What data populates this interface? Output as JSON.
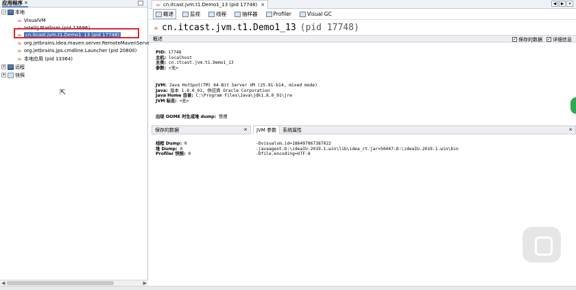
{
  "left_panel": {
    "tab_label": "应用程序",
    "tab_close": "×",
    "tree": {
      "local": "本地",
      "visualvm": "VisualVM",
      "intellij": "IntelliJ Platform (pid 13696)",
      "selected": "cn.itcast.jvm.t1.Demo1_13 (pid 17748)",
      "maven": "org.jetbrains.idea.maven.server.RemoteMavenServe",
      "launcher": "org.jetbrains.jps.cmdline.Launcher (pid 20800)",
      "local_app": "本地应用 (pid 13364)",
      "remote": "远程",
      "snapshot": "快照"
    },
    "expander_open": "−",
    "expander_closed": "+"
  },
  "right_panel": {
    "tab_label": "cn.itcast.jvm.t1.Demo1_13 (pid 17748)",
    "tab_close": "×",
    "toolbar": {
      "overview": "概述",
      "monitor": "监视",
      "threads": "线程",
      "sampler": "抽样器",
      "profiler": "Profiler",
      "visual_gc": "Visual GC"
    },
    "title_main": "cn.itcast.jvm.t1.Demo1_13",
    "title_pid": "(pid 17748)",
    "section_label": "概述",
    "cb_saved": "保存的数据",
    "cb_detail": "详细信息",
    "info": {
      "pid_label": "PID:",
      "pid": "17748",
      "host_label": "主机:",
      "host": "localhost",
      "main_label": "主类:",
      "main": "cn.itcast.jvm.t1.Demo1_13",
      "args_label": "参数:",
      "args": "<无>",
      "jvm_label": "JVM:",
      "jvm": "Java HotSpot(TM) 64-Bit Server VM (25.91-b14, mixed mode)",
      "java_label": "Java:",
      "java": "版本 1.8.0_91, 供应商 Oracle Corporation",
      "home_label": "Java Home 目录:",
      "home": "C:\\Program Files\\Java\\jdk1.8.0_91\\jre",
      "flags_label": "JVM 标志:",
      "flags": "<无>",
      "oome_label": "出现 OOME 时生成堆 dump:",
      "oome": "禁用"
    },
    "lower": {
      "saved_tab": "保存的数据",
      "jvm_args_tab": "JVM 参数",
      "sys_props_tab": "系统属性",
      "close": "×",
      "thread_dump_label": "线程 Dump:",
      "thread_dump": "0",
      "heap_dump_label": "堆 Dump:",
      "heap_dump": "0",
      "profiler_label": "Profiler 快照:",
      "profiler": "0",
      "arg1": "-Dvisualvm.id=186497867387022",
      "arg2": "-javaagent:D:\\ideaIU-2019.1.win\\lib\\idea_rt.jar=50447:D:\\ideaIU-2019.1.win\\bin",
      "arg3": "-Dfile.encoding=UTF-8"
    }
  },
  "nav": {
    "prev": "◀",
    "next": "▶",
    "menu": "▾"
  },
  "checkbox_mark": "✓",
  "cursor_glyph": "⇱",
  "colors": {
    "selection": "#3b6fc2",
    "highlight_box": "#e0242a",
    "accent_green": "#2fa84f"
  }
}
